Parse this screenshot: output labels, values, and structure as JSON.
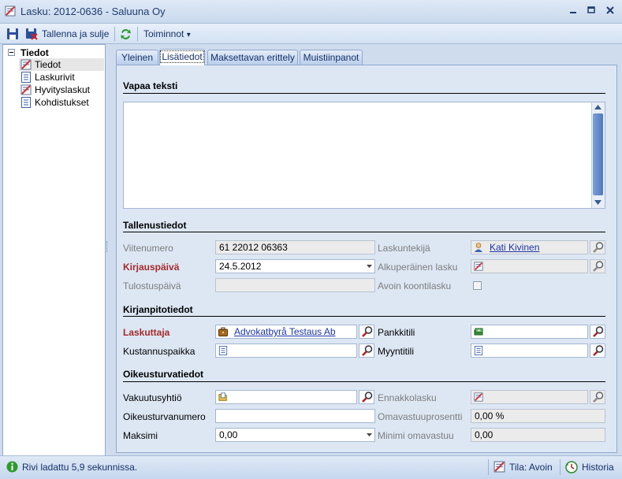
{
  "window": {
    "title": "Lasku: 2012-0636 - Saluuna Oy",
    "min_icon": "minimize-icon",
    "max_icon": "maximize-icon",
    "close_icon": "close-icon"
  },
  "toolbar": {
    "save_icon": "floppy-disk-icon",
    "save_close_label": "Tallenna ja sulje",
    "refresh_icon": "refresh-icon",
    "actions_label": "Toiminnot",
    "actions_arrow": "▾"
  },
  "tree": {
    "root": "Tiedot",
    "items": [
      {
        "label": "Tiedot",
        "icon": "invoice-icon"
      },
      {
        "label": "Laskurivit",
        "icon": "document-icon"
      },
      {
        "label": "Hyvityslaskut",
        "icon": "invoice-icon"
      },
      {
        "label": "Kohdistukset",
        "icon": "document-icon"
      }
    ]
  },
  "tabs": [
    {
      "label": "Yleinen"
    },
    {
      "label": "Lisätiedot"
    },
    {
      "label": "Maksettavan erittely"
    },
    {
      "label": "Muistiinpanot"
    }
  ],
  "sections": {
    "free_text": "Vapaa teksti",
    "save_info": "Tallenustiedot",
    "bookkeeping": "Kirjanpitotiedot",
    "legal": "Oikeusturvatiedot"
  },
  "fields": {
    "reference_label": "Viitenumero",
    "reference_value": "61 22012 06363",
    "biller_label": "Laskuntekijä",
    "biller_value": "Kati Kivinen",
    "booking_date_label": "Kirjauspäivä",
    "booking_date_value": "24.5.2012",
    "original_invoice_label": "Alkuperäinen lasku",
    "print_date_label": "Tulostuspäivä",
    "open_summary_label": "Avoin koontilasku",
    "billing_party_label": "Laskuttaja",
    "billing_party_value": "Advokatbyrå Testaus Ab",
    "bank_account_label": "Pankkitili",
    "cost_center_label": "Kustannuspaikka",
    "sales_account_label": "Myyntitili",
    "insurer_label": "Vakuutusyhtiö",
    "advance_invoice_label": "Ennakkolasku",
    "legal_number_label": "Oikeusturvanumero",
    "deductible_pct_label": "Omavastuuprosentti",
    "deductible_pct_value": "0,00 %",
    "max_label": "Maksimi",
    "max_value": "0,00",
    "min_deductible_label": "Minimi omavastuu",
    "min_deductible_value": "0,00"
  },
  "status": {
    "message": "Rivi ladattu 5,9 sekunnissa.",
    "state": "Tila: Avoin",
    "history": "Historia"
  }
}
